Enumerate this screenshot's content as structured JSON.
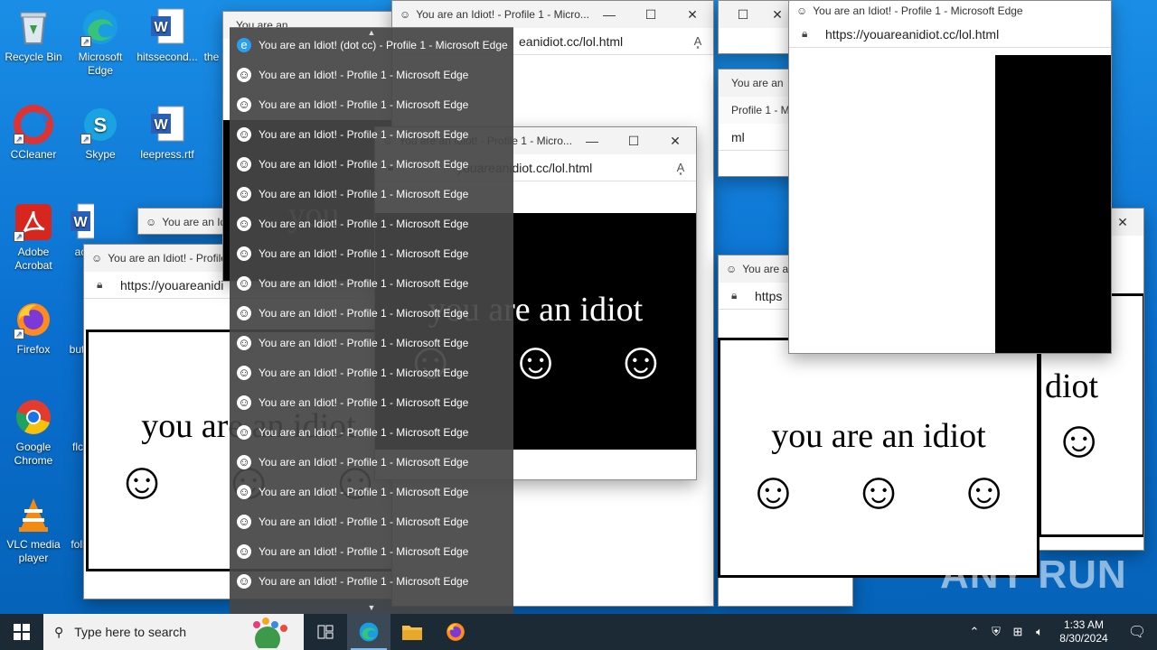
{
  "desktop": {
    "icons": [
      {
        "label": "Recycle Bin",
        "icon": "recycle-bin-icon"
      },
      {
        "label": "Microsoft Edge",
        "icon": "edge-icon"
      },
      {
        "label": "hitssecond...",
        "icon": "word-doc-icon"
      },
      {
        "label": "the",
        "icon": "word-doc-icon"
      },
      {
        "label": "CCleaner",
        "icon": "ccleaner-icon"
      },
      {
        "label": "Skype",
        "icon": "skype-icon"
      },
      {
        "label": "leepress.rtf",
        "icon": "word-doc-icon"
      },
      {
        "label": "Adobe Acrobat",
        "icon": "acrobat-icon"
      },
      {
        "label": "ac",
        "icon": "word-doc-icon"
      },
      {
        "label": "Firefox",
        "icon": "firefox-icon"
      },
      {
        "label": "but",
        "icon": "file-icon"
      },
      {
        "label": "Google Chrome",
        "icon": "chrome-icon"
      },
      {
        "label": "flc",
        "icon": "file-icon"
      },
      {
        "label": "VLC media player",
        "icon": "vlc-icon"
      },
      {
        "label": "foll",
        "icon": "file-icon"
      }
    ]
  },
  "windows": {
    "title_short": "You are an Idiot! - Profile 1 - Micro...",
    "title_full": "You are an Idiot! - Profile 1 - Microsoft Edge",
    "title_tiny": "You are an Idiot! - Profile",
    "title_fragment": "You are an Id",
    "title_fragment2": "You are an",
    "title_fragment3": "Profile 1 - Micr",
    "url": "https://youareanidiot.cc/lol.html",
    "url_partial": "eanidiot.cc/lol.html",
    "url_partial2": "youareanidiot.cc/lol.html",
    "url_fragment": "https",
    "url_fragment2": "ml",
    "url_fragment3": "https://youareanidi",
    "page_text": "you are an idiot",
    "page_text_partial": "diot",
    "page_text_partial2": "you"
  },
  "taskbar_popup": {
    "items": [
      "You are an Idiot! (dot cc) - Profile 1 - Microsoft Edge",
      "You are an Idiot! - Profile 1 - Microsoft Edge",
      "You are an Idiot! - Profile 1 - Microsoft Edge",
      "You are an Idiot! - Profile 1 - Microsoft Edge",
      "You are an Idiot! - Profile 1 - Microsoft Edge",
      "You are an Idiot! - Profile 1 - Microsoft Edge",
      "You are an Idiot! - Profile 1 - Microsoft Edge",
      "You are an Idiot! - Profile 1 - Microsoft Edge",
      "You are an Idiot! - Profile 1 - Microsoft Edge",
      "You are an Idiot! - Profile 1 - Microsoft Edge",
      "You are an Idiot! - Profile 1 - Microsoft Edge",
      "You are an Idiot! - Profile 1 - Microsoft Edge",
      "You are an Idiot! - Profile 1 - Microsoft Edge",
      "You are an Idiot! - Profile 1 - Microsoft Edge",
      "You are an Idiot! - Profile 1 - Microsoft Edge",
      "You are an Idiot! - Profile 1 - Microsoft Edge",
      "You are an Idiot! - Profile 1 - Microsoft Edge",
      "You are an Idiot! - Profile 1 - Microsoft Edge",
      "You are an Idiot! - Profile 1 - Microsoft Edge"
    ]
  },
  "taskbar": {
    "search_placeholder": "Type here to search",
    "time": "1:33 AM",
    "date": "8/30/2024"
  },
  "watermark": "ANY RUN",
  "colors": {
    "desktop_blue": "#0a6fcf",
    "taskbar": "#1c2a36",
    "popup": "#464646"
  }
}
